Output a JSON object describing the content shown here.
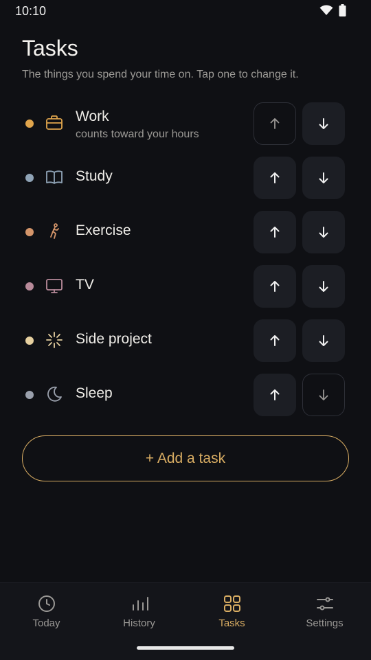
{
  "status": {
    "time": "10:10"
  },
  "header": {
    "title": "Tasks",
    "subtitle": "The things you spend your time on. Tap one to change it."
  },
  "tasks": [
    {
      "name": "Work",
      "sub": "counts toward your hours",
      "color": "#e0a54c",
      "icon": "briefcase-icon",
      "up_enabled": false,
      "down_enabled": true
    },
    {
      "name": "Study",
      "sub": "",
      "color": "#8fa3b6",
      "icon": "book-icon",
      "up_enabled": true,
      "down_enabled": true
    },
    {
      "name": "Exercise",
      "sub": "",
      "color": "#d4956a",
      "icon": "running-icon",
      "up_enabled": true,
      "down_enabled": true
    },
    {
      "name": "TV",
      "sub": "",
      "color": "#b88a9a",
      "icon": "monitor-icon",
      "up_enabled": true,
      "down_enabled": true
    },
    {
      "name": "Side project",
      "sub": "",
      "color": "#e6d0a0",
      "icon": "sparkle-icon",
      "up_enabled": true,
      "down_enabled": true
    },
    {
      "name": "Sleep",
      "sub": "",
      "color": "#9aa0ac",
      "icon": "moon-icon",
      "up_enabled": true,
      "down_enabled": false
    }
  ],
  "add_button": {
    "label": "+ Add a task"
  },
  "nav": [
    {
      "label": "Today",
      "icon": "clock-icon",
      "active": false
    },
    {
      "label": "History",
      "icon": "bar-chart-icon",
      "active": false
    },
    {
      "label": "Tasks",
      "icon": "grid-icon",
      "active": true
    },
    {
      "label": "Settings",
      "icon": "sliders-icon",
      "active": false
    }
  ],
  "colors": {
    "accent": "#d9ad63",
    "background": "#0f1014",
    "button": "#1c1e24"
  }
}
